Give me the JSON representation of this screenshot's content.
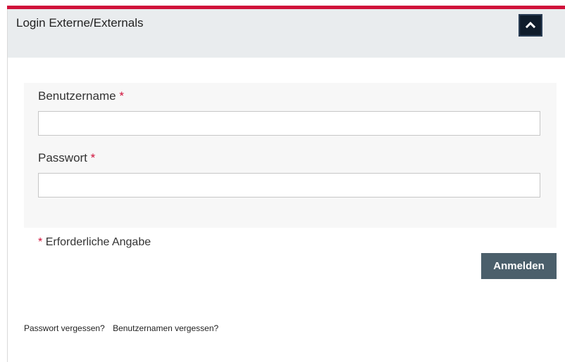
{
  "header": {
    "title": "Login Externe/Externals",
    "collapse_icon": "chevron-up-icon"
  },
  "form": {
    "username": {
      "label": "Benutzername",
      "required_marker": "*",
      "value": ""
    },
    "password": {
      "label": "Passwort",
      "required_marker": "*",
      "value": ""
    },
    "required_note": {
      "marker": "*",
      "text": "Erforderliche Angabe"
    },
    "submit_label": "Anmelden"
  },
  "links": {
    "forgot_password": "Passwort vergessen?",
    "forgot_username": "Benutzernamen vergessen?"
  },
  "colors": {
    "accent": "#d0103a",
    "header_bg": "#e9ecee",
    "button_bg": "#4b5f6b",
    "collapse_btn_bg": "#0f1c2b"
  }
}
